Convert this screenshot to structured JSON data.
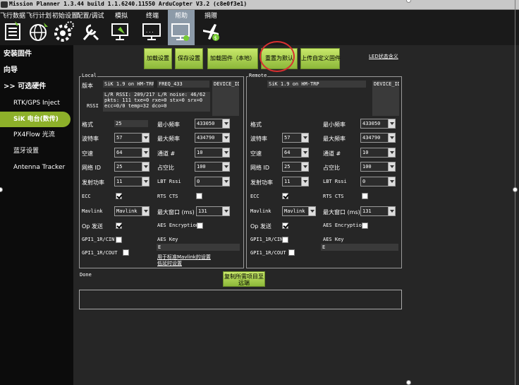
{
  "window": {
    "title": "Mission Planner 1.3.44 build 1.1.6240.11550 ArduCopter V3.2 (c8e0f3e1)"
  },
  "toolbar": {
    "items": [
      {
        "label": "飞行数据",
        "icon": "flight-data-icon"
      },
      {
        "label": "飞行计划",
        "icon": "flight-plan-icon"
      },
      {
        "label": "初始设置",
        "icon": "initial-setup-icon"
      },
      {
        "label": "配置/调试",
        "icon": "config-tuning-icon"
      },
      {
        "label": "模拟",
        "icon": "simulation-icon"
      },
      {
        "label": "终端",
        "icon": "terminal-icon"
      },
      {
        "label": "帮助",
        "icon": "help-icon"
      },
      {
        "label": "捐赠",
        "icon": "donate-icon"
      }
    ]
  },
  "sidebar": {
    "items": [
      {
        "label": "安装固件"
      },
      {
        "label": "向导"
      },
      {
        "label": ">> 可选硬件"
      },
      {
        "label": "RTK/GPS Inject"
      },
      {
        "label": "SiK 电台(数传)"
      },
      {
        "label": "PX4Flow 光流"
      },
      {
        "label": "蓝牙设置"
      },
      {
        "label": "Antenna Tracker"
      }
    ]
  },
  "buttons": {
    "load_settings": "加载设置",
    "save_settings": "保存设置",
    "load_fw_local": "加载固件（本地）",
    "reset_default": "重置为默认",
    "upload_custom_fw": "上传自定义固件",
    "copy_required": "复制所需项目至\n远端"
  },
  "led_link": "LED状态含义",
  "local": {
    "title": "Local",
    "version_label": "版本",
    "version": "SiK 1.9 on HM-TRP",
    "freq": "FREQ_433",
    "device_id": "DEVICE_ID_HM_TRP",
    "rssi_label": "RSSI",
    "rssi": "L/R RSSI: 209/217  L/R noise: 46/62 pkts: 111  txe=0 rxe=0 stx=0 srx=0 ecc=0/0 temp=32 dco=0",
    "format_label": "格式",
    "format": "25",
    "baud_label": "波特率",
    "baud": "57",
    "air_speed_label": "空速",
    "air_speed": "64",
    "net_id_label": "网络 ID",
    "net_id": "25",
    "tx_power_label": "发射功率",
    "tx_power": "11",
    "ecc_label": "ECC",
    "mavlink_label": "Mavlink",
    "mavlink": "Mavlink",
    "op_resend_label": "Op 发送",
    "gpi1_cin_label": "GPI1_1R/CIN",
    "gpi1_cout_label": "GPI1_1R/COUT",
    "min_freq_label": "最小频率",
    "min_freq": "433050",
    "max_freq_label": "最大频率",
    "max_freq": "434790",
    "channels_label": "通道 #",
    "channels": "10",
    "duty_label": "占空比",
    "duty": "100",
    "lbt_label": "LBT Rssi",
    "lbt": "0",
    "rts_label": "RTS CTS",
    "max_window_label": "最大窗口 (ms)",
    "max_window": "131",
    "aes_enc_label": "AES Encryption",
    "aes_key_label": "AES Key",
    "aes_key": "E",
    "link1": "用于标准Mavlink的设置",
    "link2": "低延时设置"
  },
  "remote": {
    "title": "Remote",
    "version": "SiK 1.9 on HM-TRP",
    "device_id": "DEVICE_ID_HM_TRP",
    "format_label": "格式",
    "format": "",
    "baud_label": "波特率",
    "baud": "57",
    "air_speed_label": "空速",
    "air_speed": "64",
    "net_id_label": "网络 ID",
    "net_id": "25",
    "tx_power_label": "发射功率",
    "tx_power": "11",
    "ecc_label": "ECC",
    "mavlink_label": "Mavlink",
    "mavlink": "Mavlink",
    "op_resend_label": "Op 发送",
    "gpi1_cin_label": "GPI1_1R/CIN",
    "gpi1_cout_label": "GPI1_1R/COUT",
    "min_freq_label": "最小频率",
    "min_freq": "433050",
    "max_freq_label": "最大频率",
    "max_freq": "434790",
    "channels_label": "通道 #",
    "channels": "10",
    "duty_label": "占空比",
    "duty": "100",
    "lbt_label": "LBT Rssi",
    "lbt": "0",
    "rts_label": "RTS CTS",
    "max_window_label": "最大窗口 (ms)",
    "max_window": "131",
    "aes_enc_label": "AES Encryption",
    "aes_key_label": "AES Key",
    "aes_key": "E"
  },
  "status": {
    "label": "Done"
  },
  "colors": {
    "accent": "#8db02a",
    "button": "#a8d050",
    "highlight": "#d83030"
  }
}
